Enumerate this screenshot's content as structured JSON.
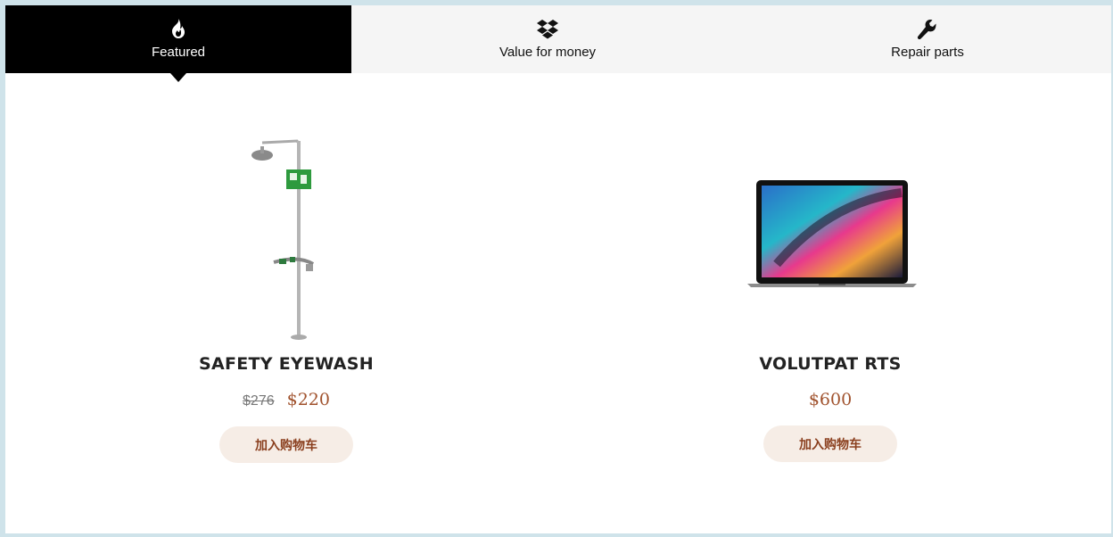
{
  "tabs": [
    {
      "label": "Featured",
      "icon": "fire-icon",
      "active": true
    },
    {
      "label": "Value for money",
      "icon": "dropbox-icon",
      "active": false
    },
    {
      "label": "Repair parts",
      "icon": "wrench-icon",
      "active": false
    }
  ],
  "products": [
    {
      "name": "SAFETY EYEWASH",
      "old_price": "$276",
      "price": "$220",
      "button": "加入购物车",
      "image": "safety-eyewash-station"
    },
    {
      "name": "VOLUTPAT RTS",
      "old_price": "",
      "price": "$600",
      "button": "加入购物车",
      "image": "laptop"
    }
  ],
  "colors": {
    "active_tab": "#000000",
    "price": "#a0522d",
    "button_bg": "#f6ede6",
    "button_text": "#8a3f1e"
  }
}
